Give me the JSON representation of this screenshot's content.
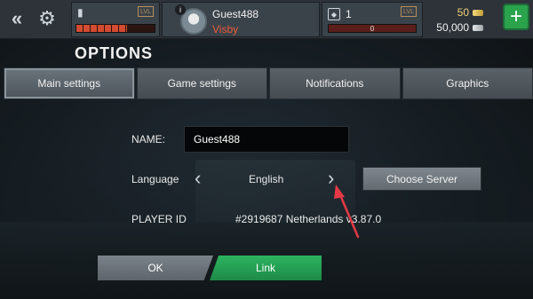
{
  "topbar": {
    "energy_badge": "LVL",
    "energy_level": 0.65,
    "profile": {
      "username": "Guest488",
      "location": "Visby"
    },
    "rank": {
      "level": "1",
      "badge": "LVL",
      "progress": "0"
    },
    "currency": {
      "gold": "50",
      "silver": "50,000"
    }
  },
  "page": {
    "title": "OPTIONS"
  },
  "tabs": [
    {
      "label": "Main settings"
    },
    {
      "label": "Game settings"
    },
    {
      "label": "Notifications"
    },
    {
      "label": "Graphics"
    }
  ],
  "form": {
    "name_label": "NAME:",
    "name_value": "Guest488",
    "language_label": "Language",
    "language_value": "English",
    "choose_server_label": "Choose Server",
    "player_id_label": "PLAYER ID",
    "player_id_value": "#2919687 Netherlands v3.87.0"
  },
  "buttons": {
    "ok": "OK",
    "link": "Link"
  },
  "colors": {
    "accent_green": "#2aa34c",
    "alert_red": "#e85b3c",
    "annotation_red": "#e63946"
  }
}
